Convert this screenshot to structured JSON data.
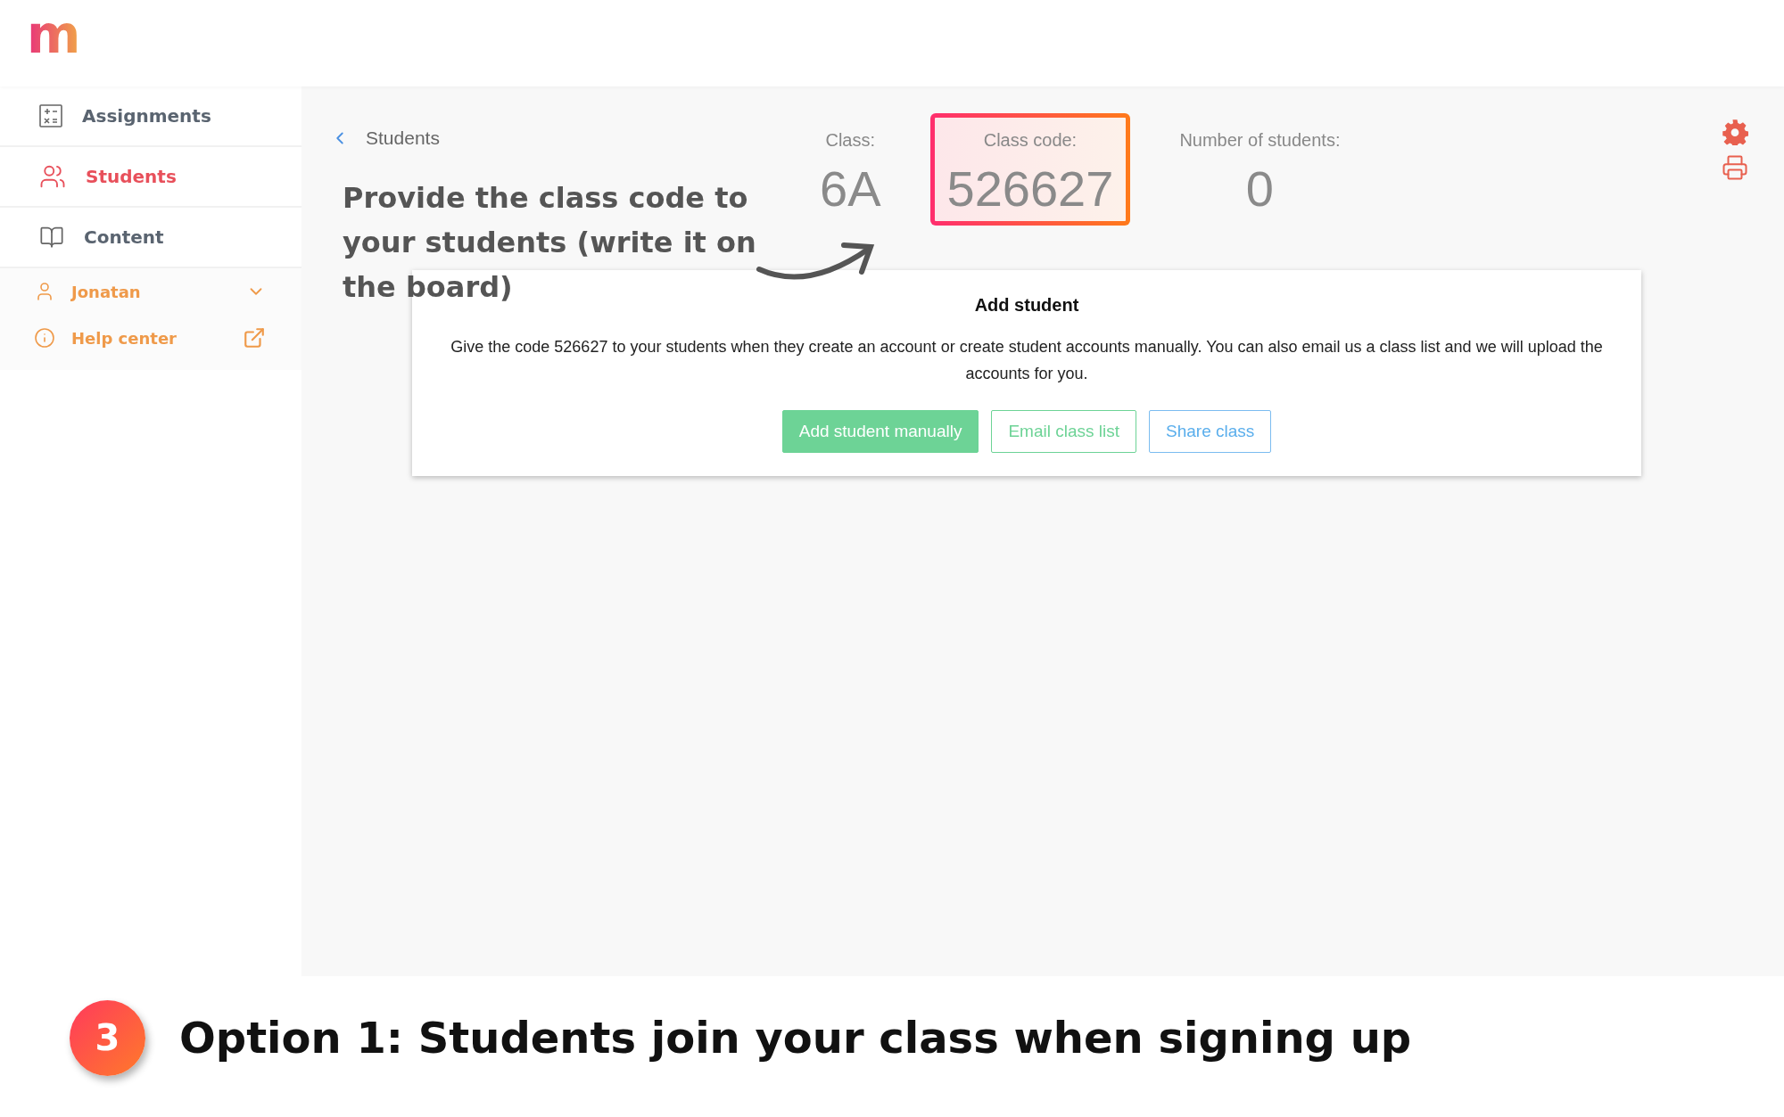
{
  "logo": "m",
  "sidebar": {
    "items": [
      {
        "kind": "assignments",
        "label": "Assignments",
        "selected": false
      },
      {
        "kind": "students",
        "label": "Students",
        "selected": true
      },
      {
        "kind": "content",
        "label": "Content",
        "selected": false
      }
    ],
    "account": {
      "name": "Jonatan"
    },
    "help": {
      "label": "Help center"
    }
  },
  "header": {
    "back_title": "Students",
    "stats": [
      {
        "label": "Class:",
        "value": "6A",
        "highlighted": false
      },
      {
        "label": "Class code:",
        "value": "526627",
        "highlighted": true
      },
      {
        "label": "Number of students:",
        "value": "0",
        "highlighted": false
      }
    ]
  },
  "annotation": "Provide the class code to your students (write it on the board)",
  "dialog": {
    "title": "Add student",
    "text": "Give the code 526627 to your students when they create an account or create student accounts manually. You can also email us a class list and we will upload the accounts for you.",
    "buttons": [
      {
        "label": "Add student manually",
        "kind": "primary"
      },
      {
        "label": "Email class list",
        "kind": "outline"
      },
      {
        "label": "Share class",
        "kind": "info"
      }
    ]
  },
  "caption": {
    "step": "3",
    "text": "Option 1: Students join your class when signing up"
  }
}
